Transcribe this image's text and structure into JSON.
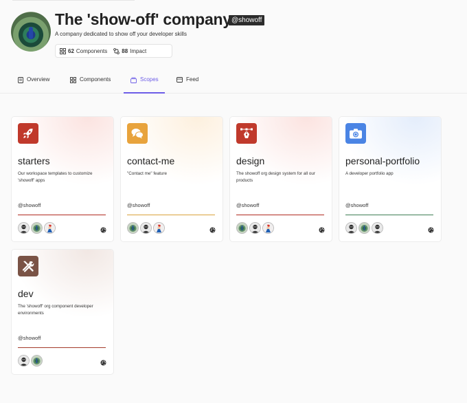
{
  "org": {
    "name": "The 'show-off' company",
    "handle": "@showoff",
    "description": "A company dedicated to show off your developer skills",
    "stats": [
      {
        "count": "62",
        "label": "Components",
        "icon": "grid-icon"
      },
      {
        "count": "88",
        "label": "Impact",
        "icon": "impact-icon"
      }
    ]
  },
  "tabs": [
    {
      "label": "Overview",
      "icon": "overview-icon",
      "active": false
    },
    {
      "label": "Components",
      "icon": "grid-icon",
      "active": false
    },
    {
      "label": "Scopes",
      "icon": "scopes-icon",
      "active": true
    },
    {
      "label": "Feed",
      "icon": "feed-icon",
      "active": false
    }
  ],
  "scopes": [
    {
      "name": "starters",
      "description": "Our workspace templates to customize 'showoff' apps",
      "owner": "@showoff",
      "icon": "rocket-icon",
      "icon_color": "#c0392b",
      "line_color": "#b02a1f",
      "glow": "#fbe3e0",
      "visibility_icon": "globe-icon"
    },
    {
      "name": "contact-me",
      "description": "\"Contact me\" feature",
      "owner": "@showoff",
      "icon": "chat-bubbles-icon",
      "icon_color": "#e8a33c",
      "line_color": "#d9a23a",
      "glow": "#fdf0de",
      "visibility_icon": "globe-icon"
    },
    {
      "name": "design",
      "description": "The showoff org design system for all our products",
      "owner": "@showoff",
      "icon": "pen-tool-icon",
      "icon_color": "#c0392b",
      "line_color": "#b02a1f",
      "glow": "#fbe3e0",
      "visibility_icon": "globe-icon"
    },
    {
      "name": "personal-portfolio",
      "description": "A developer portfolio app",
      "owner": "@showoff",
      "icon": "camera-icon",
      "icon_color": "#4a84e4",
      "line_color": "#3f7d54",
      "glow": "#e4edfb",
      "visibility_icon": "globe-icon"
    },
    {
      "name": "dev",
      "description": "The 'showoff' org component developer environments",
      "owner": "@showoff",
      "icon": "tools-icon",
      "icon_color": "#7a5346",
      "line_color": "#a33a2a",
      "glow": "#f1e7e3",
      "visibility_icon": "globe-icon"
    }
  ]
}
